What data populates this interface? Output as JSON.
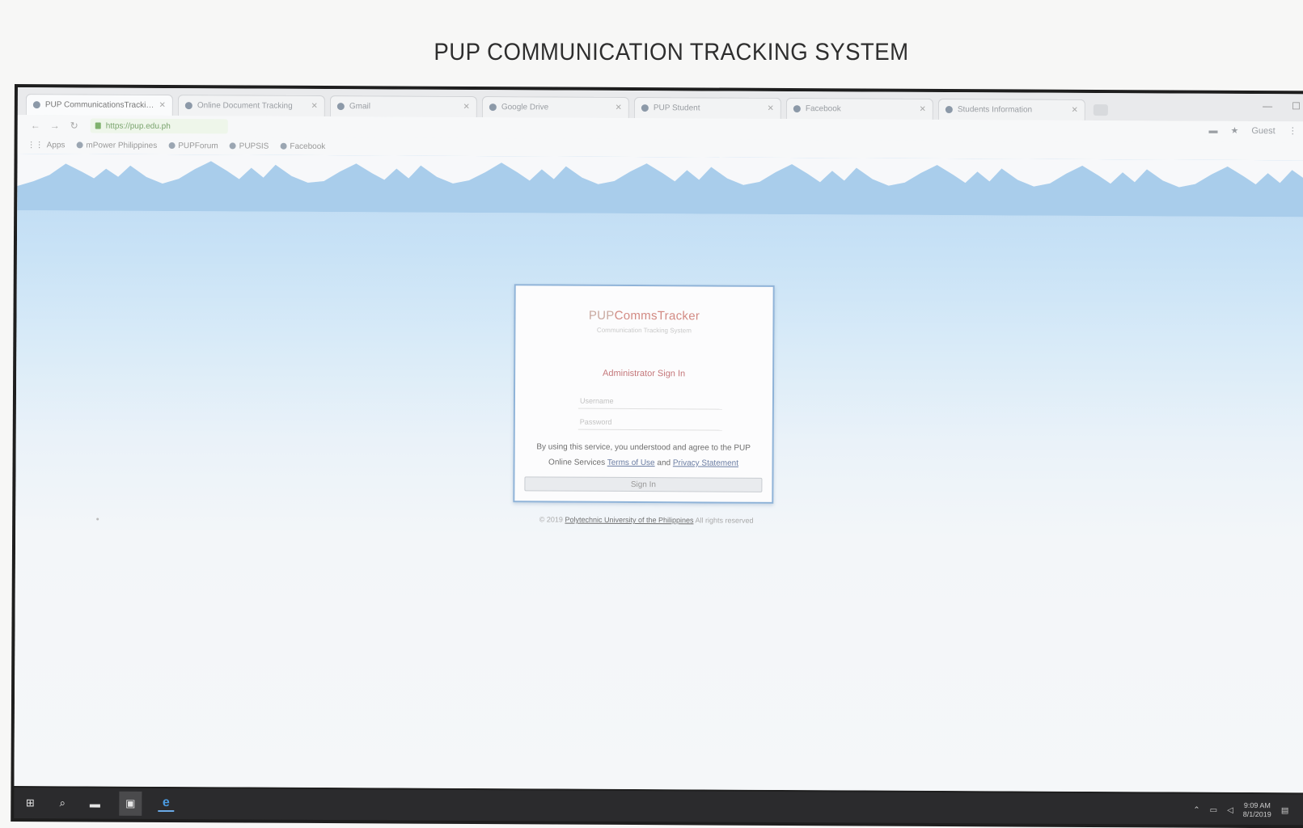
{
  "document": {
    "title": "PUP COMMUNICATION TRACKING SYSTEM"
  },
  "browser": {
    "tabs": [
      {
        "label": "PUP CommunicationsTracking"
      },
      {
        "label": "Online Document Tracking"
      },
      {
        "label": "Gmail"
      },
      {
        "label": "Google Drive"
      },
      {
        "label": "PUP Student"
      },
      {
        "label": "Facebook"
      },
      {
        "label": "Students Information"
      }
    ],
    "address": "https://pup.edu.ph",
    "user_label": "Guest",
    "bookmarks": [
      {
        "label": "Apps"
      },
      {
        "label": "mPower Philippines"
      },
      {
        "label": "PUPForum"
      },
      {
        "label": "PUPSIS"
      },
      {
        "label": "Facebook"
      }
    ]
  },
  "login": {
    "logo_part1": "PUP",
    "logo_part2": "CommsTracker",
    "logo_sub": "Communication Tracking System",
    "heading": "Administrator Sign In",
    "username_placeholder": "Username",
    "password_placeholder": "Password",
    "terms_prefix": "By using this service, you understood and agree to the PUP Online Services",
    "terms_link1": "Terms of Use",
    "terms_and": "and",
    "terms_link2": "Privacy Statement",
    "button_label": "Sign In"
  },
  "footer": {
    "prefix": "© 2019",
    "link": "Polytechnic University of the Philippines",
    "suffix": "All rights reserved"
  },
  "taskbar": {
    "time": "9:09 AM",
    "date": "8/1/2019"
  }
}
